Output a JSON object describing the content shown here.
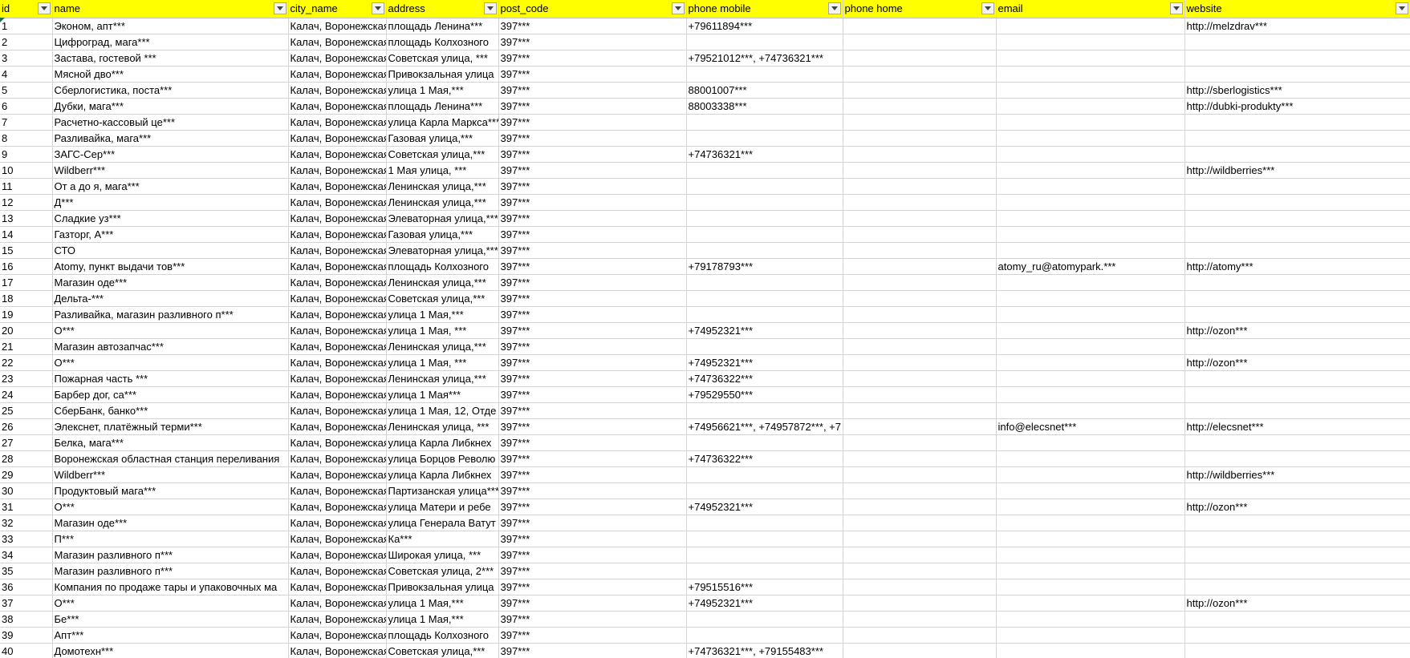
{
  "columns": [
    "id",
    "name",
    "city_name",
    "address",
    "post_code",
    "phone mobile",
    "phone home",
    "email",
    "website"
  ],
  "rows": [
    [
      "1",
      "Эконом, апт***",
      "Калач, Воронежская",
      "площадь Ленина***",
      "397***",
      "+79611894***",
      "",
      "",
      "http://melzdrav***"
    ],
    [
      "2",
      "Цифроград, мага***",
      "Калач, Воронежская",
      "площадь Колхозного",
      "397***",
      "",
      "",
      "",
      ""
    ],
    [
      "3",
      "Застава, гостевой ***",
      "Калач, Воронежская",
      "Советская улица, ***",
      "397***",
      "+79521012***, +74736321***",
      "",
      "",
      ""
    ],
    [
      "4",
      "Мясной дво***",
      "Калач, Воронежская",
      "Привокзальная улица",
      "397***",
      "",
      "",
      "",
      ""
    ],
    [
      "5",
      "Сберлогистика, поста***",
      "Калач, Воронежская",
      "улица 1 Мая,***",
      "397***",
      "88001007***",
      "",
      "",
      "http://sberlogistics***"
    ],
    [
      "6",
      "Дубки, мага***",
      "Калач, Воронежская",
      "площадь Ленина***",
      "397***",
      "88003338***",
      "",
      "",
      "http://dubki-produkty***"
    ],
    [
      "7",
      "Расчетно-кассовый це***",
      "Калач, Воронежская",
      "улица Карла Маркса***",
      "397***",
      "",
      "",
      "",
      ""
    ],
    [
      "8",
      "Разливайка, мага***",
      "Калач, Воронежская",
      "Газовая улица,***",
      "397***",
      "",
      "",
      "",
      ""
    ],
    [
      "9",
      "ЗАГС-Сер***",
      "Калач, Воронежская",
      "Советская улица,***",
      "397***",
      "+74736321***",
      "",
      "",
      ""
    ],
    [
      "10",
      "Wildberr***",
      "Калач, Воронежская",
      "1 Мая улица, ***",
      "397***",
      "",
      "",
      "",
      "http://wildberries***"
    ],
    [
      "11",
      "От а до я, мага***",
      "Калач, Воронежская",
      "Ленинская улица,***",
      "397***",
      "",
      "",
      "",
      ""
    ],
    [
      "12",
      "Д***",
      "Калач, Воронежская",
      "Ленинская улица,***",
      "397***",
      "",
      "",
      "",
      ""
    ],
    [
      "13",
      "Сладкие уз***",
      "Калач, Воронежская",
      "Элеваторная улица,***",
      "397***",
      "",
      "",
      "",
      ""
    ],
    [
      "14",
      "Газторг, А***",
      "Калач, Воронежская",
      "Газовая улица,***",
      "397***",
      "",
      "",
      "",
      ""
    ],
    [
      "15",
      "СТО",
      "Калач, Воронежская",
      "Элеваторная улица,***",
      "397***",
      "",
      "",
      "",
      ""
    ],
    [
      "16",
      "Atomy, пункт выдачи тов***",
      "Калач, Воронежская",
      "площадь Колхозного",
      "397***",
      "+79178793***",
      "",
      "atomy_ru@atomypark.***",
      "http://atomy***"
    ],
    [
      "17",
      "Магазин оде***",
      "Калач, Воронежская",
      "Ленинская улица,***",
      "397***",
      "",
      "",
      "",
      ""
    ],
    [
      "18",
      "Дельта-***",
      "Калач, Воронежская",
      "Советская улица,***",
      "397***",
      "",
      "",
      "",
      ""
    ],
    [
      "19",
      "Разливайка, магазин разливного п***",
      "Калач, Воронежская",
      "улица 1 Мая,***",
      "397***",
      "",
      "",
      "",
      ""
    ],
    [
      "20",
      "О***",
      "Калач, Воронежская",
      "улица 1 Мая, ***",
      "397***",
      "+74952321***",
      "",
      "",
      "http://ozon***"
    ],
    [
      "21",
      "Магазин автозапчас***",
      "Калач, Воронежская",
      "Ленинская улица,***",
      "397***",
      "",
      "",
      "",
      ""
    ],
    [
      "22",
      "О***",
      "Калач, Воронежская",
      "улица 1 Мая, ***",
      "397***",
      "+74952321***",
      "",
      "",
      "http://ozon***"
    ],
    [
      "23",
      "Пожарная часть ***",
      "Калач, Воронежская",
      "Ленинская улица,***",
      "397***",
      "+74736322***",
      "",
      "",
      ""
    ],
    [
      "24",
      "Барбер дог, са***",
      "Калач, Воронежская",
      "улица 1 Мая***",
      "397***",
      "+79529550***",
      "",
      "",
      ""
    ],
    [
      "25",
      "СберБанк, банко***",
      "Калач, Воронежская",
      "улица 1 Мая, 12, Отде",
      "397***",
      "",
      "",
      "",
      ""
    ],
    [
      "26",
      "Элекснет, платёжный терми***",
      "Калач, Воронежская",
      "Ленинская улица, ***",
      "397***",
      "+74956621***, +74957872***, +7",
      "",
      "info@elecsnet***",
      "http://elecsnet***"
    ],
    [
      "27",
      "Белка, мага***",
      "Калач, Воронежская",
      "улица Карла Либкнех",
      "397***",
      "",
      "",
      "",
      ""
    ],
    [
      "28",
      "Воронежская областная станция переливания",
      "Калач, Воронежская",
      "улица Борцов Револю",
      "397***",
      "+74736322***",
      "",
      "",
      ""
    ],
    [
      "29",
      "Wildberr***",
      "Калач, Воронежская",
      "улица Карла Либкнех",
      "397***",
      "",
      "",
      "",
      "http://wildberries***"
    ],
    [
      "30",
      "Продуктовый мага***",
      "Калач, Воронежская",
      "Партизанская улица***",
      "397***",
      "",
      "",
      "",
      ""
    ],
    [
      "31",
      "О***",
      "Калач, Воронежская",
      "улица Матери и ребе",
      "397***",
      "+74952321***",
      "",
      "",
      "http://ozon***"
    ],
    [
      "32",
      "Магазин оде***",
      "Калач, Воронежская",
      "улица Генерала Ватут",
      "397***",
      "",
      "",
      "",
      ""
    ],
    [
      "33",
      "П***",
      "Калач, Воронежская",
      "Ка***",
      "397***",
      "",
      "",
      "",
      ""
    ],
    [
      "34",
      "Магазин разливного п***",
      "Калач, Воронежская",
      "Широкая улица, ***",
      "397***",
      "",
      "",
      "",
      ""
    ],
    [
      "35",
      "Магазин разливного п***",
      "Калач, Воронежская",
      "Советская улица, 2***",
      "397***",
      "",
      "",
      "",
      ""
    ],
    [
      "36",
      "Компания по продаже тары и упаковочных ма",
      "Калач, Воронежская",
      "Привокзальная улица",
      "397***",
      "+79515516***",
      "",
      "",
      ""
    ],
    [
      "37",
      "О***",
      "Калач, Воронежская",
      "улица 1 Мая,***",
      "397***",
      "+74952321***",
      "",
      "",
      "http://ozon***"
    ],
    [
      "38",
      "Бе***",
      "Калач, Воронежская",
      "улица 1 Мая,***",
      "397***",
      "",
      "",
      "",
      ""
    ],
    [
      "39",
      "Апт***",
      "Калач, Воронежская",
      "площадь Колхозного",
      "397***",
      "",
      "",
      "",
      ""
    ],
    [
      "40",
      "Домотехн***",
      "Калач, Воронежская",
      "Советская улица,***",
      "397***",
      "+74736321***, +79155483***",
      "",
      "",
      ""
    ]
  ],
  "colors": {
    "header_bg": "#ffff00",
    "gridline": "#d4d4d4"
  },
  "icons": {
    "filter": "dropdown-arrow-icon"
  }
}
